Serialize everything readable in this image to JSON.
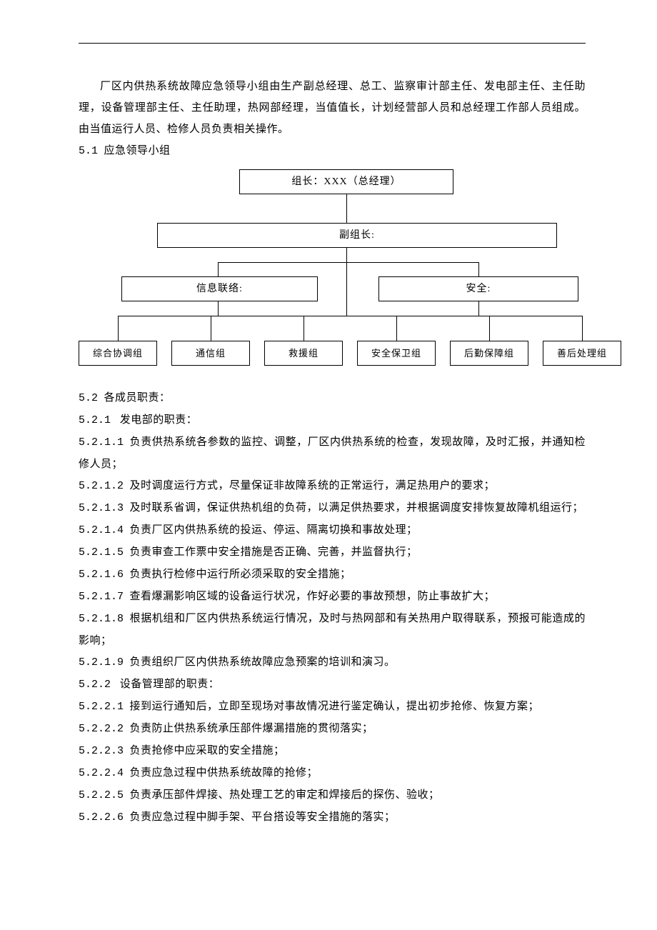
{
  "intro": "厂区内供热系统故障应急领导小组由生产副总经理、总工、监察审计部主任、发电部主任、主任助理，设备管理部主任、主任助理，热网部经理，当值值长，计划经营部人员和总经理工作部人员组成。由当值运行人员、检修人员负责相关操作。",
  "sec51_num": "5.1",
  "sec51_title": "应急领导小组",
  "chart": {
    "leader": "组长：XXX（总经理）",
    "deputy": "副组长:",
    "info": "信息联络:",
    "safety": "安全:",
    "leaves": [
      "综合协调组",
      "通信组",
      "救援组",
      "安全保卫组",
      "后勤保障组",
      "善后处理组"
    ]
  },
  "sec52_num": "5.2",
  "sec52_title": "各成员职责：",
  "sec521_num": "5.2.1",
  "sec521_title": "发电部的职责：",
  "p5211_num": "5.2.1.1",
  "p5211": "负责供热系统各参数的监控、调整，厂区内供热系统的检查，发现故障，及时汇报，并通知检修人员；",
  "p5212_num": "5.2.1.2",
  "p5212": "及时调度运行方式，尽量保证非故障系统的正常运行，满足热用户的要求；",
  "p5213_num": "5.2.1.3",
  "p5213": "及时联系省调，保证供热机组的负荷，以满足供热要求，并根据调度安排恢复故障机组运行；",
  "p5214_num": "5.2.1.4",
  "p5214": "负责厂区内供热系统的投运、停运、隔离切换和事故处理；",
  "p5215_num": "5.2.1.5",
  "p5215": "负责审查工作票中安全措施是否正确、完善，并监督执行；",
  "p5216_num": "5.2.1.6",
  "p5216": "负责执行检修中运行所必须采取的安全措施；",
  "p5217_num": "5.2.1.7",
  "p5217": "查看爆漏影响区域的设备运行状况，作好必要的事故预想，防止事故扩大；",
  "p5218_num": "5.2.1.8",
  "p5218": "根据机组和厂区内供热系统运行情况，及时与热网部和有关热用户取得联系，预报可能造成的影响；",
  "p5219_num": "5.2.1.9",
  "p5219": "负责组织厂区内供热系统故障应急预案的培训和演习。",
  "sec522_num": "5.2.2",
  "sec522_title": "设备管理部的职责：",
  "p5221_num": "5.2.2.1",
  "p5221": "接到运行通知后，立即至现场对事故情况进行鉴定确认，提出初步抢修、恢复方案；",
  "p5222_num": "5.2.2.2",
  "p5222": "负责防止供热系统承压部件爆漏措施的贯彻落实；",
  "p5223_num": "5.2.2.3",
  "p5223": "负责抢修中应采取的安全措施；",
  "p5224_num": "5.2.2.4",
  "p5224": "负责应急过程中供热系统故障的抢修；",
  "p5225_num": "5.2.2.5",
  "p5225": "负责承压部件焊接、热处理工艺的审定和焊接后的探伤、验收；",
  "p5226_num": "5.2.2.6",
  "p5226": "负责应急过程中脚手架、平台搭设等安全措施的落实；"
}
